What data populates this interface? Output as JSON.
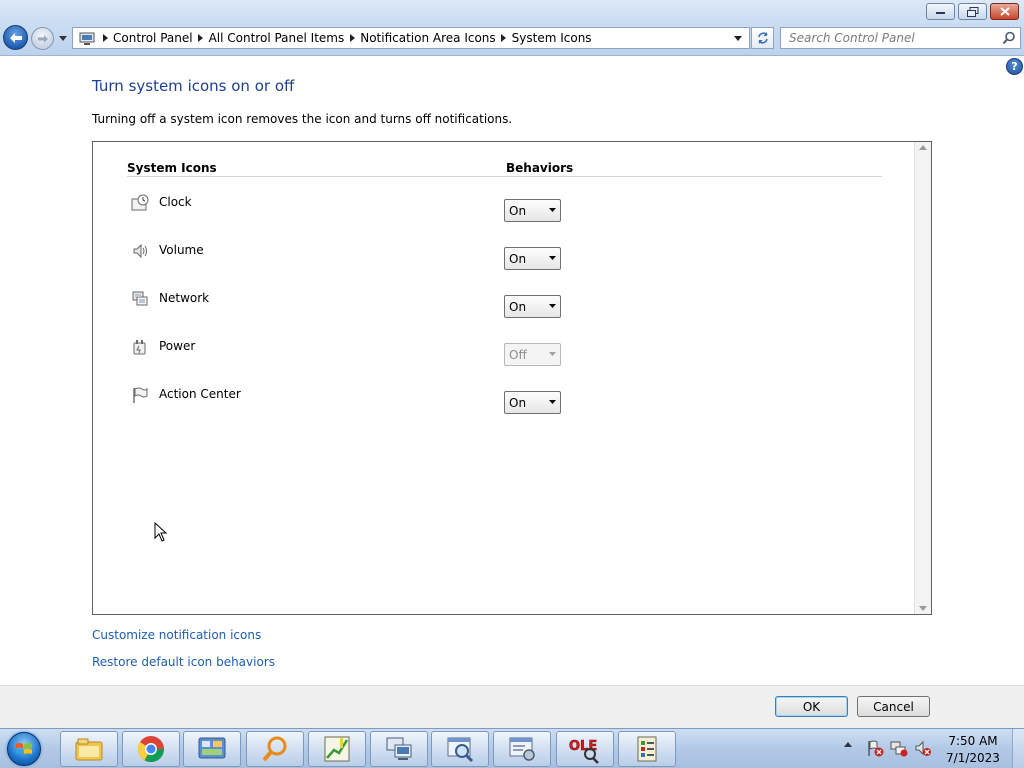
{
  "window": {
    "minimize_icon": "minimize-icon",
    "maximize_icon": "restore-icon",
    "close_icon": "close-icon"
  },
  "address": {
    "crumbs": [
      "Control Panel",
      "All Control Panel Items",
      "Notification Area Icons",
      "System Icons"
    ],
    "search_placeholder": "Search Control Panel"
  },
  "main": {
    "title": "Turn system icons on or off",
    "description": "Turning off a system icon removes the icon and turns off notifications.",
    "col_icons": "System Icons",
    "col_behaviors": "Behaviors",
    "rows": [
      {
        "label": "Clock",
        "icon": "clock-icon",
        "value": "On",
        "enabled": true
      },
      {
        "label": "Volume",
        "icon": "speaker-icon",
        "value": "On",
        "enabled": true
      },
      {
        "label": "Network",
        "icon": "network-icon",
        "value": "On",
        "enabled": true
      },
      {
        "label": "Power",
        "icon": "power-plug-icon",
        "value": "Off",
        "enabled": false
      },
      {
        "label": "Action Center",
        "icon": "flag-icon",
        "value": "On",
        "enabled": true
      }
    ],
    "link_customize": "Customize notification icons",
    "link_restore": "Restore default icon behaviors"
  },
  "footer": {
    "ok_label": "OK",
    "cancel_label": "Cancel"
  },
  "taskbar": {
    "apps": [
      "windows-explorer-icon",
      "chrome-icon",
      "control-panel-icon",
      "search-magnifier-icon",
      "chart-editor-icon",
      "network-computer-icon",
      "magnifier-window-icon",
      "settings-window-icon",
      "ole-viewer-icon",
      "registry-tool-icon"
    ],
    "time": "7:50 AM",
    "date": "7/1/2023"
  },
  "colors": {
    "title": "#1e3f8f",
    "link": "#1e5db0",
    "taskbar": "#b2c9e6"
  }
}
